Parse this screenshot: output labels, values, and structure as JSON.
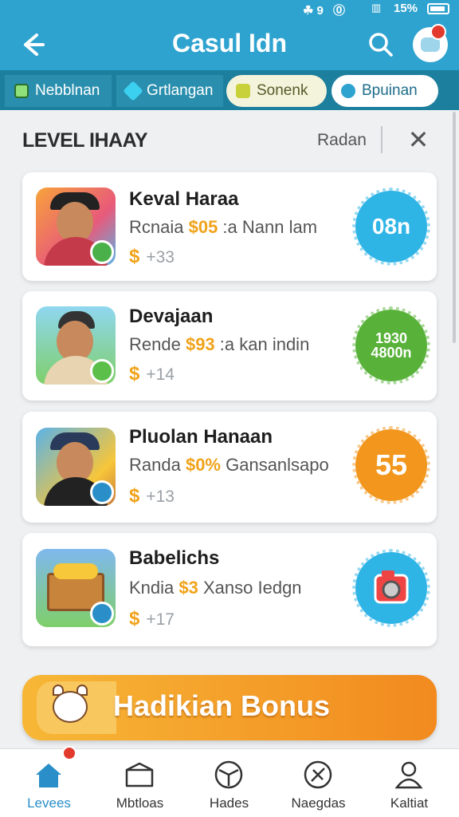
{
  "status_bar": {
    "icons_text": "☘9 ⓪",
    "battery_text": "15%"
  },
  "header": {
    "title": "Casul Idn",
    "back_icon": "arrow-left-icon",
    "search_icon": "search-icon",
    "chat_icon": "chat-icon"
  },
  "tabs": [
    {
      "label": "Nebblnan",
      "icon": "book-icon"
    },
    {
      "label": "Grtlangan",
      "icon": "diamond-icon"
    },
    {
      "label": "Sonenk",
      "icon": "ticket-icon"
    },
    {
      "label": "Bpuinan",
      "icon": "info-circle-icon"
    }
  ],
  "section": {
    "title": "LEVEL IHAAY",
    "sort_label": "Radan",
    "close_label": "✕"
  },
  "items": [
    {
      "name": "Keval Haraa",
      "desc_prefix": "Rcnaia ",
      "desc_highlight": "$05",
      "desc_suffix": " :a Nann lam",
      "currency": "$",
      "count": "+33",
      "badge": "08n",
      "badge_color": "#2fb4e6"
    },
    {
      "name": "Devajaan",
      "desc_prefix": "Rende ",
      "desc_highlight": "$93",
      "desc_suffix": " :a kan indin",
      "currency": "$",
      "count": "+14",
      "badge": "1930 4800n",
      "badge_color": "#58b23a"
    },
    {
      "name": "Pluolan Hanaan",
      "desc_prefix": "Randa ",
      "desc_highlight": "$0%",
      "desc_suffix": " Gansanlsapo",
      "currency": "$",
      "count": "+13",
      "badge": "55",
      "badge_color": "#f2961d"
    },
    {
      "name": "Babelichs",
      "desc_prefix": "Kndia ",
      "desc_highlight": "$3",
      "desc_suffix": " Xanso Iedgn",
      "currency": "$",
      "count": "+17",
      "badge": "",
      "badge_color": "#2fb4e6"
    }
  ],
  "bonus": {
    "label": "Hadikian Bonus"
  },
  "bottom_nav": [
    {
      "label": "Levees",
      "icon": "home-icon",
      "active": true
    },
    {
      "label": "Mbtloas",
      "icon": "box-icon",
      "active": false
    },
    {
      "label": "Hades",
      "icon": "steering-wheel-icon",
      "active": false
    },
    {
      "label": "Naegdas",
      "icon": "tools-icon",
      "active": false
    },
    {
      "label": "Kaltiat",
      "icon": "user-icon",
      "active": false
    }
  ]
}
